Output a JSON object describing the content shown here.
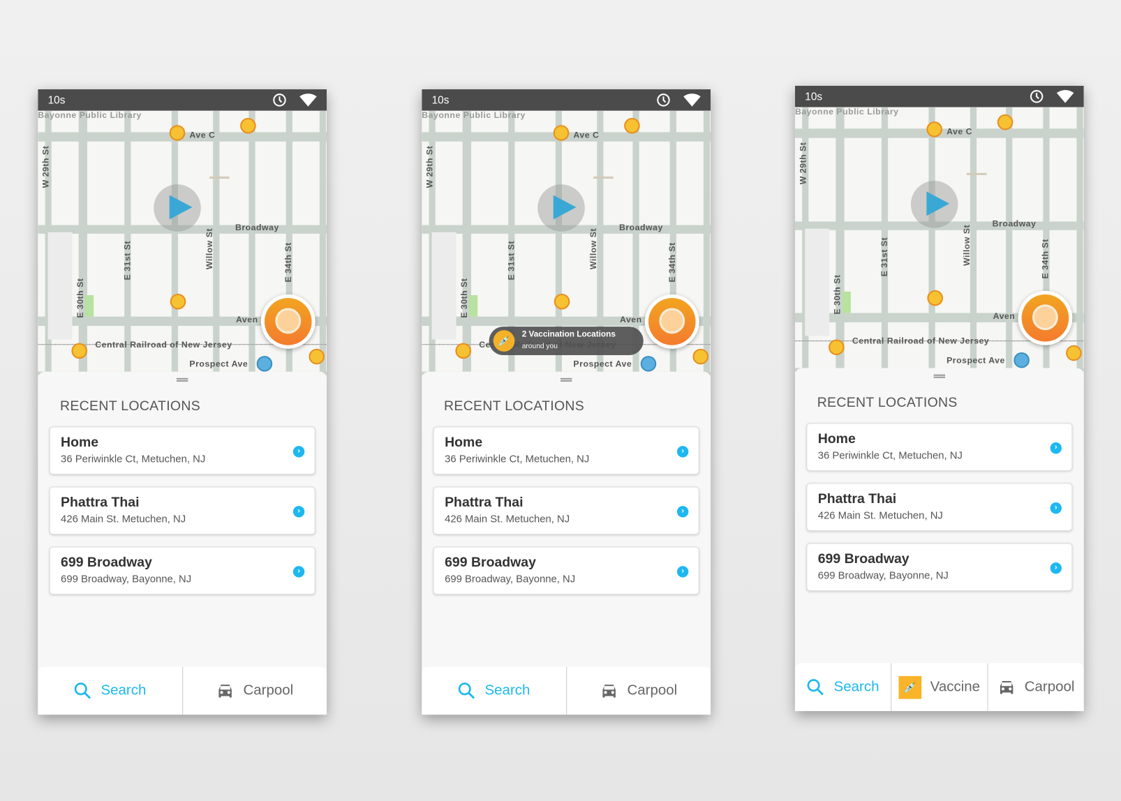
{
  "colors": {
    "accent": "#1cb8ee",
    "status_bar": "#4b4b4b",
    "orange": "#f47b2e",
    "vaccine": "#f9b42a"
  },
  "map": {
    "poi": "Bayonne Public Library",
    "streets": [
      "Ave C",
      "W 29th St",
      "Broadway",
      "E 31st St",
      "Willow St",
      "E 30th St",
      "E 34th St",
      "Aven",
      "Central Railroad of New Jersey",
      "Prospect Ave"
    ]
  },
  "phones": [
    {
      "status_time": "10s",
      "toast": null,
      "recent_title": "RECENT LOCATIONS",
      "locations": [
        {
          "name": "Home",
          "address": "36 Periwinkle Ct, Metuchen, NJ"
        },
        {
          "name": "Phattra Thai",
          "address": "426 Main St. Metuchen, NJ"
        },
        {
          "name": "699 Broadway",
          "address": "699 Broadway, Bayonne, NJ"
        }
      ],
      "nav": [
        {
          "label": "Search",
          "icon": "search-icon",
          "active": true
        },
        {
          "label": "Carpool",
          "icon": "car-icon"
        }
      ]
    },
    {
      "status_time": "10s",
      "toast": {
        "title": "2 Vaccination Locations",
        "subtitle": "around you",
        "icon": "vaccine-icon"
      },
      "recent_title": "RECENT LOCATIONS",
      "locations": [
        {
          "name": "Home",
          "address": "36 Periwinkle Ct, Metuchen, NJ"
        },
        {
          "name": "Phattra Thai",
          "address": "426 Main St. Metuchen, NJ"
        },
        {
          "name": "699 Broadway",
          "address": "699 Broadway, Bayonne, NJ"
        }
      ],
      "nav": [
        {
          "label": "Search",
          "icon": "search-icon",
          "active": true
        },
        {
          "label": "Carpool",
          "icon": "car-icon"
        }
      ]
    },
    {
      "status_time": "10s",
      "toast": null,
      "recent_title": "RECENT LOCATIONS",
      "locations": [
        {
          "name": "Home",
          "address": "36 Periwinkle Ct, Metuchen, NJ"
        },
        {
          "name": "Phattra Thai",
          "address": "426 Main St. Metuchen, NJ"
        },
        {
          "name": "699 Broadway",
          "address": "699 Broadway, Bayonne, NJ"
        }
      ],
      "nav": [
        {
          "label": "Search",
          "icon": "search-icon",
          "active": true
        },
        {
          "label": "Vaccine",
          "icon": "vaccine-icon"
        },
        {
          "label": "Carpool",
          "icon": "car-icon"
        }
      ]
    }
  ]
}
